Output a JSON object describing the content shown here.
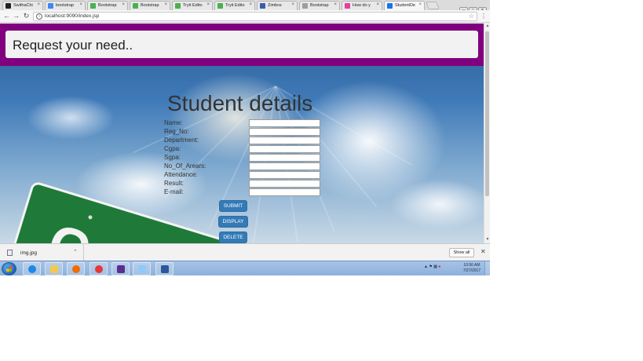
{
  "tabs": [
    {
      "label": "SwithaChi",
      "favicon": "github-icon",
      "color": "#222222"
    },
    {
      "label": "bootstrap",
      "favicon": "google-icon",
      "color": "#4285f4"
    },
    {
      "label": "Bootstrap",
      "favicon": "w3schools-icon",
      "color": "#4caf50"
    },
    {
      "label": "Bootstrap",
      "favicon": "w3schools-icon",
      "color": "#4caf50"
    },
    {
      "label": "Tryit Edito",
      "favicon": "w3schools-icon",
      "color": "#4caf50"
    },
    {
      "label": "Tryit Edito",
      "favicon": "w3schools-icon",
      "color": "#4caf50"
    },
    {
      "label": "Zimbra:",
      "favicon": "zimbra-icon",
      "color": "#3b5ca8"
    },
    {
      "label": "Bootstrap",
      "favicon": "page-icon",
      "color": "#9e9e9e"
    },
    {
      "label": "How do y",
      "favicon": "quora-icon",
      "color": "#e040a0"
    },
    {
      "label": "StudentDe",
      "favicon": "page-icon",
      "color": "#1a73e8",
      "active": true
    }
  ],
  "address_bar": {
    "url": "localhost:9090/index.jsp"
  },
  "banner": {
    "title": "Request your need..",
    "color": "#800080"
  },
  "form": {
    "title": "Student details",
    "fields": [
      "Name:",
      "Reg_No:",
      "Department:",
      "Cgpa:",
      "Sgpa:",
      "No_Of_Arears:",
      "Attendance:",
      "Result:",
      "E-mail:"
    ],
    "values": [
      "",
      "",
      "",
      "",
      "",
      "",
      "",
      "",
      ""
    ],
    "buttons": {
      "submit": "SUBMIT",
      "display": "DISPLAY",
      "delete": "DELETE"
    },
    "button_color": "#337ab7"
  },
  "download_bar": {
    "file": "img.jpg",
    "show_all": "Show all"
  },
  "taskbar": {
    "apps": [
      "ie-icon",
      "explorer-icon",
      "media-player-icon",
      "chrome-icon",
      "visual-studio-icon",
      "notepad-icon",
      "word-icon"
    ],
    "time": "10:56 AM",
    "date": "7/27/2017"
  }
}
